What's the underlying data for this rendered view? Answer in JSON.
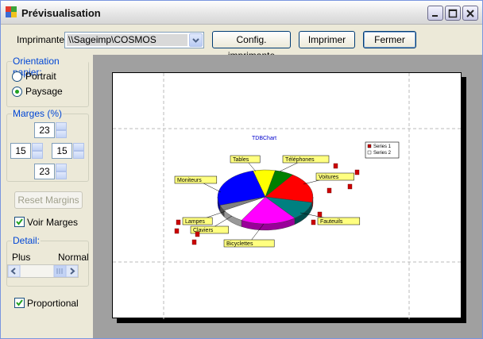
{
  "window": {
    "title": "Prévisualisation"
  },
  "toolbar": {
    "printer_label": "Imprimante:",
    "printer_value": "\\\\Sageimp\\COSMOS",
    "config_button": "Config. imprimante",
    "print_button": "Imprimer",
    "close_button": "Fermer"
  },
  "orientation": {
    "title": "Orientation papier:",
    "portrait": "Portrait",
    "landscape": "Paysage",
    "selected": "Paysage"
  },
  "margins": {
    "title": "Marges (%)",
    "top": "23",
    "left": "15",
    "right": "15",
    "bottom": "23"
  },
  "reset_button": "Reset Margins",
  "show_margins": {
    "label": "Voir Marges",
    "checked": true
  },
  "detail": {
    "title": "Detail:",
    "low_label": "Plus",
    "high_label": "Normal"
  },
  "proportional": {
    "label": "Proportional",
    "checked": true
  },
  "chart_data": {
    "type": "pie",
    "title": "TDBChart",
    "legend": {
      "placement": "top-right",
      "entries": [
        "Series 1",
        "Series 2"
      ]
    },
    "slice_labels": [
      "Tables",
      "Téléphones",
      "Voitures",
      "Fauteuils",
      "Bicyclettes",
      "Claviers",
      "Lampes",
      "Moniteurs"
    ],
    "colors": [
      "#ffff00",
      "#008000",
      "#ff0000",
      "#008080",
      "#ff00ff",
      "#ffffff",
      "#808080",
      "#0000ff"
    ]
  }
}
